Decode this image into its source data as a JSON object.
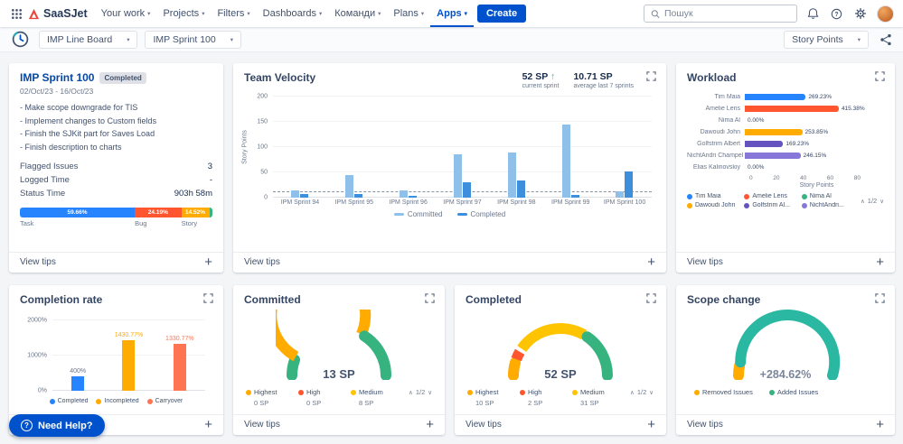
{
  "icons": {
    "chevron_down": "▾",
    "pager_up": "∧",
    "pager_down": "∨",
    "plus": "+",
    "trend_up": "↑",
    "question_mark": "?"
  },
  "topnav": {
    "logo_text": "SaaSJet",
    "items": [
      {
        "label": "Your work"
      },
      {
        "label": "Projects"
      },
      {
        "label": "Filters"
      },
      {
        "label": "Dashboards"
      },
      {
        "label": "Команди"
      },
      {
        "label": "Plans"
      },
      {
        "label": "Apps",
        "active": true
      }
    ],
    "create_label": "Create",
    "search_placeholder": "Пошук"
  },
  "toolbar": {
    "board_select": "IMP Line Board",
    "sprint_select": "IMP Sprint 100",
    "metric_select": "Story Points"
  },
  "labels": {
    "view_tips": "View tips"
  },
  "sprint_card": {
    "title": "IMP Sprint 100",
    "badge": "Completed",
    "date_range": "02/Oct/23 - 16/Oct/23",
    "notes": [
      "- Make scope downgrade for TIS",
      "- Implement changes to Custom fields",
      "- Finish the SJKit part for Saves Load",
      "- Finish description to charts"
    ],
    "stats": [
      {
        "label": "Flagged Issues",
        "value": "3"
      },
      {
        "label": "Logged Time",
        "value": "-"
      },
      {
        "label": "Status Time",
        "value": "903h 58m"
      }
    ]
  },
  "velocity_card": {
    "title": "Team Velocity",
    "current_value": "52 SP",
    "current_note": "current sprint",
    "average_value": "10.71 SP",
    "average_note": "average last 7 sprints"
  },
  "workload_card": {
    "title": "Workload",
    "pagination": "1/2"
  },
  "completion_card": {
    "title": "Completion rate"
  },
  "committed_card": {
    "title": "Committed",
    "value": "13 SP",
    "pagination": "1/2",
    "legend": [
      {
        "label": "Highest",
        "value": "0 SP",
        "color": "#FFAB00"
      },
      {
        "label": "High",
        "value": "0 SP",
        "color": "#FF5630"
      },
      {
        "label": "Medium",
        "value": "8 SP",
        "color": "#FFC400"
      }
    ]
  },
  "completed_card": {
    "title": "Completed",
    "value": "52 SP",
    "pagination": "1/2",
    "legend": [
      {
        "label": "Highest",
        "value": "10 SP",
        "color": "#FFAB00"
      },
      {
        "label": "High",
        "value": "2 SP",
        "color": "#FF5630"
      },
      {
        "label": "Medium",
        "value": "31 SP",
        "color": "#FFC400"
      }
    ]
  },
  "scope_card": {
    "title": "Scope change",
    "value": "+284.62%",
    "legend": [
      {
        "label": "Removed Issues",
        "color": "#FFAB00"
      },
      {
        "label": "Added Issues",
        "color": "#36B37E"
      }
    ]
  },
  "need_help": "Need Help?",
  "chart_data": [
    {
      "id": "issue-type-distribution",
      "type": "bar",
      "stacked": true,
      "segments": [
        {
          "label": "Task",
          "pct": 59.66,
          "color": "#2684FF"
        },
        {
          "label": "Bug",
          "pct": 24.19,
          "color": "#FF5630"
        },
        {
          "label": "Story",
          "pct": 14.52,
          "color": "#FFAB00"
        },
        {
          "label": "",
          "pct": 1.63,
          "color": "#36B37E"
        }
      ]
    },
    {
      "id": "team-velocity",
      "type": "bar",
      "categories": [
        "IPM Sprint 94",
        "IPM Sprint 95",
        "IPM Sprint 96",
        "IPM Sprint 97",
        "IPM Sprint 98",
        "IPM Sprint 99",
        "IPM Sprint 100"
      ],
      "series": [
        {
          "name": "Committed",
          "color": "#8FC0EA",
          "values": [
            15,
            44,
            15,
            86,
            90,
            145,
            13
          ]
        },
        {
          "name": "Completed",
          "color": "#3E8FDB",
          "values": [
            8,
            8,
            4,
            30,
            34,
            6,
            52
          ]
        }
      ],
      "ylabel": "Story Points",
      "ylim": [
        0,
        200
      ],
      "yticks": [
        0,
        50,
        100,
        150,
        200
      ],
      "average_line": 10.71,
      "legend_position": "bottom"
    },
    {
      "id": "workload",
      "type": "bar",
      "orientation": "horizontal",
      "categories": [
        "Tim Maia",
        "Amelie Lens",
        "Nima Al",
        "Dawoudi John",
        "Golfstrim Albert",
        "NichtAndri Champel",
        "Elias Kalinovskiy"
      ],
      "values": [
        35,
        54,
        0,
        33,
        22,
        32,
        0
      ],
      "value_labels": [
        "269.23%",
        "415.38%",
        "0.00%",
        "253.85%",
        "169.23%",
        "246.15%",
        "0.00%"
      ],
      "colors": [
        "#2684FF",
        "#FF5630",
        "#36B37E",
        "#FFAB00",
        "#6554C0",
        "#8777D9",
        "#00B8D9"
      ],
      "xlabel": "Story Points",
      "xlim": [
        0,
        80
      ],
      "xticks": [
        0,
        20,
        40,
        60,
        80
      ],
      "legend": [
        {
          "label": "Tim Maia",
          "color": "#2684FF"
        },
        {
          "label": "Amelie Lens",
          "color": "#FF5630"
        },
        {
          "label": "Nima Al",
          "color": "#36B37E"
        },
        {
          "label": "Dawoudi John",
          "color": "#FFAB00"
        },
        {
          "label": "Golfstrim Al...",
          "color": "#6554C0"
        },
        {
          "label": "NichtAndri...",
          "color": "#8777D9"
        }
      ]
    },
    {
      "id": "completion-rate",
      "type": "bar",
      "categories": [
        "Completed",
        "Incompleted",
        "Carryover"
      ],
      "values": [
        400,
        1430.77,
        1330.77
      ],
      "value_labels": [
        "400%",
        "1430.77%",
        "1330.77%"
      ],
      "label_colors": [
        "#6B778C",
        "#FFAB00",
        "#FF7452"
      ],
      "colors": [
        "#2684FF",
        "#FFAB00",
        "#FF7452"
      ],
      "ylim": [
        0,
        2000
      ],
      "yticks": [
        "0%",
        "1000%",
        "2000%"
      ]
    },
    {
      "id": "committed-gauge",
      "type": "gauge",
      "value": "13 SP",
      "segments": [
        {
          "color": "#36B37E",
          "frac": 0.12
        },
        {
          "color": "#FFAB00",
          "frac": 0.55
        },
        {
          "color": "#36B37E",
          "frac": 0.33
        }
      ]
    },
    {
      "id": "completed-gauge",
      "type": "gauge",
      "value": "52 SP",
      "segments": [
        {
          "color": "#FFAB00",
          "frac": 0.1
        },
        {
          "color": "#FF5630",
          "frac": 0.08
        },
        {
          "color": "#FFC400",
          "frac": 0.5
        },
        {
          "color": "#36B37E",
          "frac": 0.32
        }
      ]
    },
    {
      "id": "scope-change-gauge",
      "type": "gauge",
      "value": "+284.62%",
      "segments": [
        {
          "color": "#FFAB00",
          "frac": 0.08
        },
        {
          "color": "#2BB8A3",
          "frac": 0.92
        }
      ]
    }
  ]
}
